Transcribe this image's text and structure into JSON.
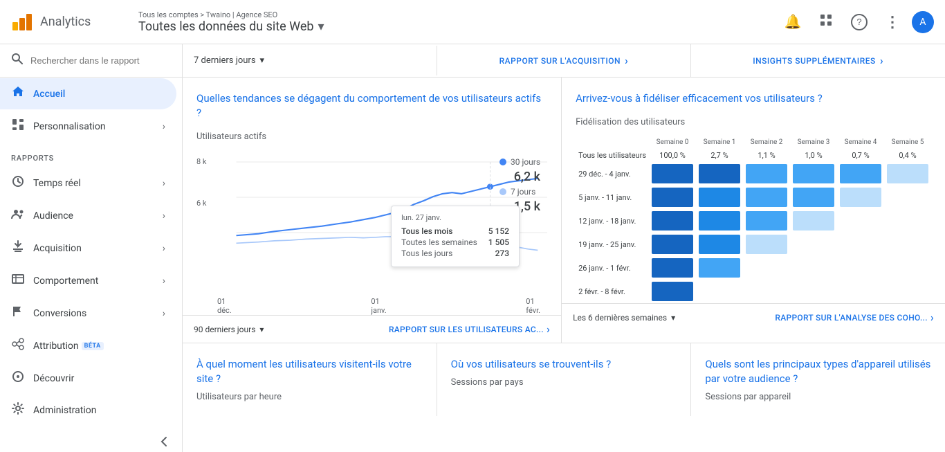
{
  "header": {
    "app_title": "Analytics",
    "breadcrumb": "Tous les comptes > Twaino | Agence SEO",
    "account_name": "Toutes les données du site Web",
    "dropdown_arrow": "▾"
  },
  "header_icons": {
    "bell": "🔔",
    "grid": "⊞",
    "help": "?",
    "more": "⋮",
    "avatar": "A"
  },
  "topbar": {
    "date_range": "7 derniers jours",
    "acquisition_link": "RAPPORT SUR L'ACQUISITION",
    "insights_link": "INSIGHTS SUPPLÉMENTAIRES"
  },
  "sidebar": {
    "search_placeholder": "Rechercher dans le rapport",
    "home": "Accueil",
    "personalisation": "Personnalisation",
    "rapports_label": "RAPPORTS",
    "temps_reel": "Temps réel",
    "audience": "Audience",
    "acquisition": "Acquisition",
    "comportement": "Comportement",
    "conversions": "Conversions",
    "attribution": "Attribution",
    "attribution_beta": "BÉTA",
    "decouvrir": "Découvrir",
    "administration": "Administration"
  },
  "left_panel": {
    "question": "Quelles tendances se dégagent du comportement de vos utilisateurs actifs ?",
    "chart_title": "Utilisateurs actifs",
    "legend_30j": "30 jours",
    "legend_30j_val": "6,2 k",
    "legend_7j": "7 jours",
    "legend_7j_val": "1,5 k",
    "x_labels": [
      "01\ndéc.",
      "01\njanv.",
      "01\nfévr."
    ],
    "y_labels": [
      "8 k",
      "6 k"
    ],
    "tooltip_date": "lun. 27 janv.",
    "tooltip_row1_label": "Tous les mois",
    "tooltip_row1_val": "5 152",
    "tooltip_row2_label": "Toutes les semaines",
    "tooltip_row2_val": "1 505",
    "tooltip_row3_label": "Tous les jours",
    "tooltip_row3_val": "273",
    "footer_period": "90 derniers jours",
    "footer_link": "RAPPORT SUR LES UTILISATEURS AC..."
  },
  "right_panel": {
    "question": "Arrivez-vous à fidéliser efficacement vos utilisateurs ?",
    "chart_title": "Fidélisation des utilisateurs",
    "col_headers": [
      "Semaine 0",
      "Semaine 1",
      "Semaine 2",
      "Semaine 3",
      "Semaine 4",
      "Semaine 5"
    ],
    "row_all_label": "Tous les utilisateurs",
    "row_all_pcts": [
      "100,0 %",
      "2,7 %",
      "1,1 %",
      "1,0 %",
      "0,7 %",
      "0,4 %"
    ],
    "rows": [
      {
        "label": "29 déc. - 4 janv.",
        "heat": [
          1.0,
          0.85,
          0.55,
          0.45,
          0.35,
          0.25
        ]
      },
      {
        "label": "5 janv. - 11 janv.",
        "heat": [
          1.0,
          0.8,
          0.5,
          0.3,
          0.2,
          0.0
        ]
      },
      {
        "label": "12 janv. - 18 janv.",
        "heat": [
          1.0,
          0.7,
          0.35,
          0.25,
          0.0,
          0.0
        ]
      },
      {
        "label": "19 janv. - 25 janv.",
        "heat": [
          1.0,
          0.6,
          0.25,
          0.0,
          0.0,
          0.0
        ]
      },
      {
        "label": "26 janv. - 1 févr.",
        "heat": [
          1.0,
          0.5,
          0.0,
          0.0,
          0.0,
          0.0
        ]
      },
      {
        "label": "2 févr. - 8 févr.",
        "heat": [
          1.0,
          0.0,
          0.0,
          0.0,
          0.0,
          0.0
        ]
      }
    ],
    "footer_period": "Les 6 dernières semaines",
    "footer_link": "RAPPORT SUR L'ANALYSE DES COHO..."
  },
  "bottom_panels": [
    {
      "question": "À quel moment les utilisateurs visitent-ils votre site ?",
      "subtitle": "Utilisateurs par heure"
    },
    {
      "question": "Où vos utilisateurs se trouvent-ils ?",
      "subtitle": "Sessions par pays"
    },
    {
      "question": "Quels sont les principaux types d'appareil utilisés par votre audience ?",
      "subtitle": "Sessions par appareil"
    }
  ],
  "colors": {
    "accent_blue": "#1a73e8",
    "light_blue": "#4285f4",
    "heat_dark": "#1565c0",
    "heat_mid": "#42a5f5",
    "heat_light": "#b3e5fc",
    "line_30d": "#4285f4",
    "line_7d": "#a8c8fa"
  }
}
